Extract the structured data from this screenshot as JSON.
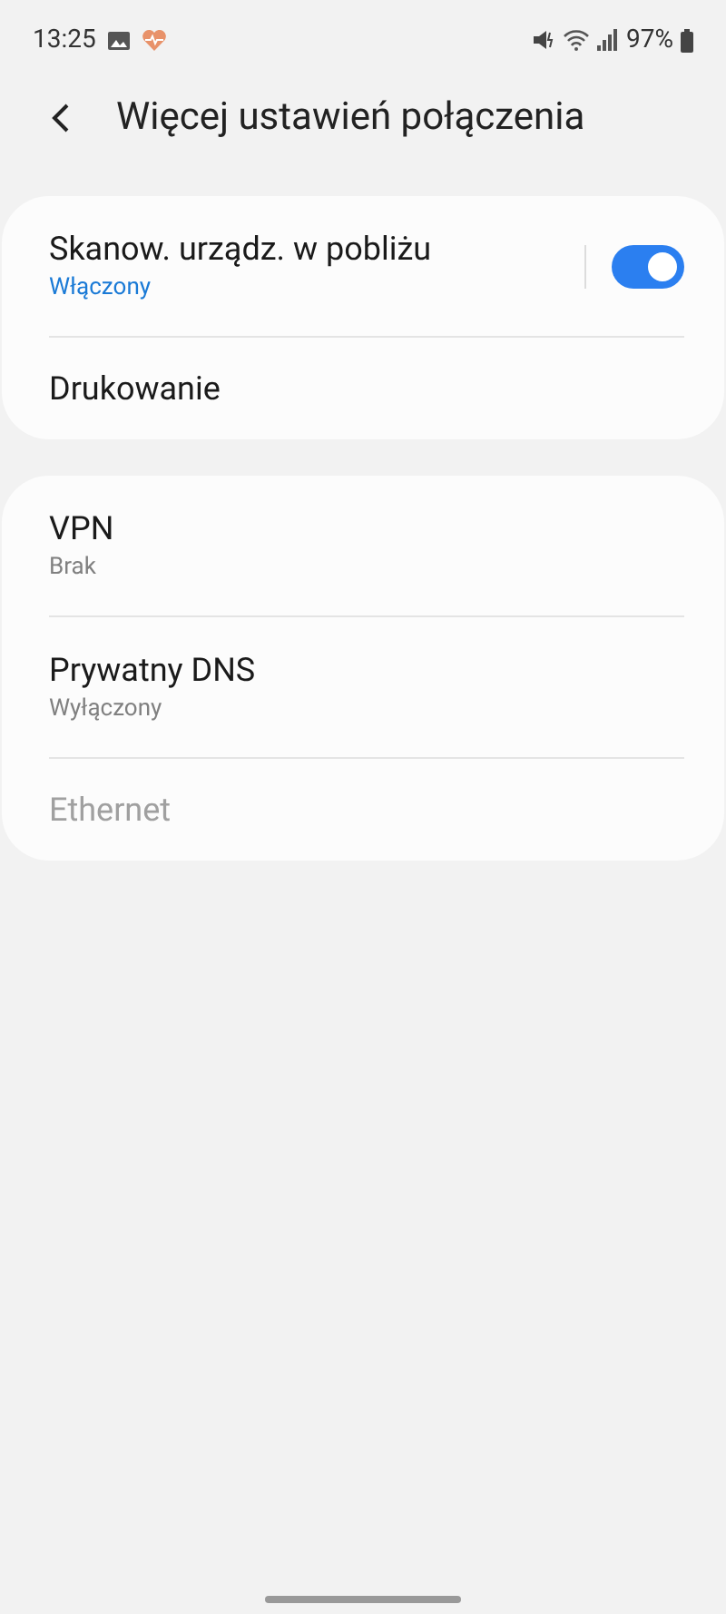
{
  "status_bar": {
    "time": "13:25",
    "battery": "97%"
  },
  "header": {
    "title": "Więcej ustawień połączenia"
  },
  "groups": [
    {
      "items": [
        {
          "kind": "toggle",
          "title": "Skanow. urządz. w pobliżu",
          "subtitle": "Włączony",
          "on": true,
          "disabled": false
        },
        {
          "kind": "link",
          "title": "Drukowanie",
          "disabled": false
        }
      ]
    },
    {
      "items": [
        {
          "kind": "link",
          "title": "VPN",
          "subtitle": "Brak",
          "disabled": false
        },
        {
          "kind": "link",
          "title": "Prywatny DNS",
          "subtitle": "Wyłączony",
          "disabled": false
        },
        {
          "kind": "link",
          "title": "Ethernet",
          "disabled": true
        }
      ]
    }
  ]
}
